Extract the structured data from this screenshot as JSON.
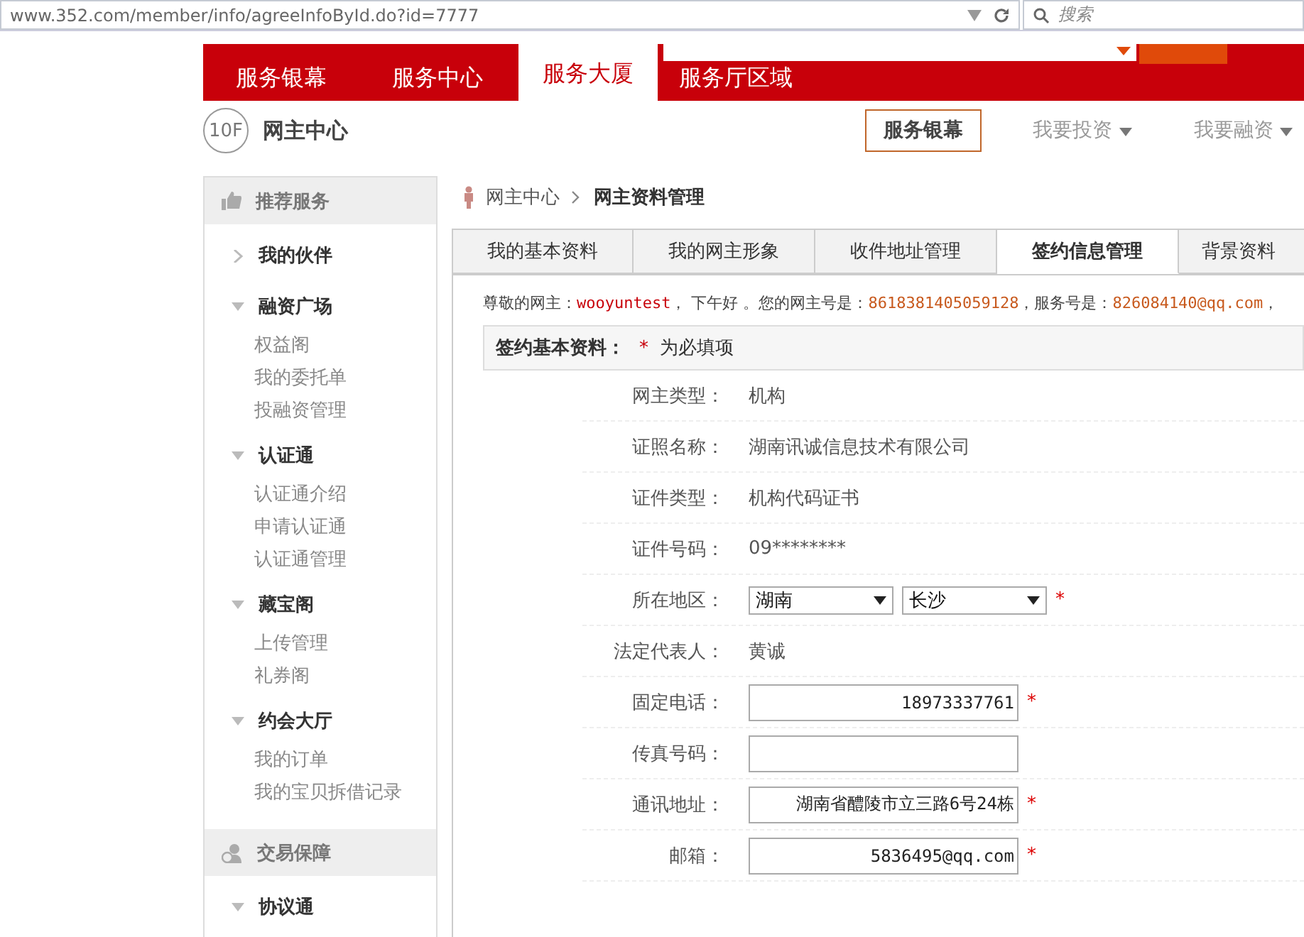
{
  "browser": {
    "url": "www.352.com/member/info/agreeInfoById.do?id=7777",
    "search_placeholder": "搜索"
  },
  "nav": {
    "tabs": [
      {
        "label": "服务银幕",
        "selected": false
      },
      {
        "label": "服务中心",
        "selected": false
      },
      {
        "label": "服务大厦",
        "selected": true
      },
      {
        "label": "服务厅区域",
        "selected": false
      }
    ]
  },
  "subheader": {
    "floor_badge": "10F",
    "title": "网主中心",
    "active_button": "服务银幕",
    "menus": [
      "我要投资",
      "我要融资"
    ]
  },
  "sidebar": {
    "sections": [
      {
        "title": "推荐服务",
        "kind": "thumb",
        "groups": [
          {
            "label": "我的伙伴",
            "expanded": false
          },
          {
            "label": "融资广场",
            "expanded": true,
            "children": [
              "权益阁",
              "我的委托单",
              "投融资管理"
            ]
          },
          {
            "label": "认证通",
            "expanded": true,
            "children": [
              "认证通介绍",
              "申请认证通",
              "认证通管理"
            ]
          },
          {
            "label": "藏宝阁",
            "expanded": true,
            "children": [
              "上传管理",
              "礼券阁"
            ]
          },
          {
            "label": "约会大厅",
            "expanded": true,
            "children": [
              "我的订单",
              "我的宝贝拆借记录"
            ]
          }
        ]
      },
      {
        "title": "交易保障",
        "kind": "shield",
        "groups": [
          {
            "label": "协议通",
            "expanded": true
          }
        ]
      }
    ]
  },
  "breadcrumb": [
    "网主中心",
    "网主资料管理"
  ],
  "tabs": [
    {
      "label": "我的基本资料",
      "selected": false
    },
    {
      "label": "我的网主形象",
      "selected": false
    },
    {
      "label": "收件地址管理",
      "selected": false
    },
    {
      "label": "签约信息管理",
      "selected": true
    },
    {
      "label": "背景资料",
      "selected": false
    }
  ],
  "greeting": [
    {
      "text": "尊敬的网主：",
      "kind": "plain"
    },
    {
      "text": "wooyuntest",
      "kind": "name"
    },
    {
      "text": "， 下午好 。您的网主号是：",
      "kind": "plain"
    },
    {
      "text": "8618381405059128",
      "kind": "value"
    },
    {
      "text": "，服务号是：",
      "kind": "plain"
    },
    {
      "text": "826084140@qq.com",
      "kind": "value"
    },
    {
      "text": "，",
      "kind": "plain"
    }
  ],
  "section": {
    "title": "签约基本资料：",
    "required_mark": "*",
    "note": "为必填项"
  },
  "fields": [
    {
      "label": "网主类型：",
      "kind": "text",
      "value": "机构",
      "required": false
    },
    {
      "label": "证照名称：",
      "kind": "text",
      "value": "湖南讯诚信息技术有限公司",
      "required": false
    },
    {
      "label": "证件类型：",
      "kind": "text",
      "value": "机构代码证书",
      "required": false
    },
    {
      "label": "证件号码：",
      "kind": "text",
      "value": "09********",
      "required": false
    },
    {
      "label": "所在地区：",
      "kind": "selects",
      "options": [
        "湖南",
        "长沙"
      ],
      "required": true
    },
    {
      "label": "法定代表人：",
      "kind": "text",
      "value": "黄诚",
      "required": false
    },
    {
      "label": "固定电话：",
      "kind": "input",
      "value": "18973337761",
      "required": true
    },
    {
      "label": "传真号码：",
      "kind": "input",
      "required": false
    },
    {
      "label": "通讯地址：",
      "kind": "input",
      "value": "湖南省醴陵市立三路6号24栋",
      "required": true
    },
    {
      "label": "邮箱：",
      "kind": "input",
      "value": "5836495@qq.com",
      "required": true
    }
  ]
}
